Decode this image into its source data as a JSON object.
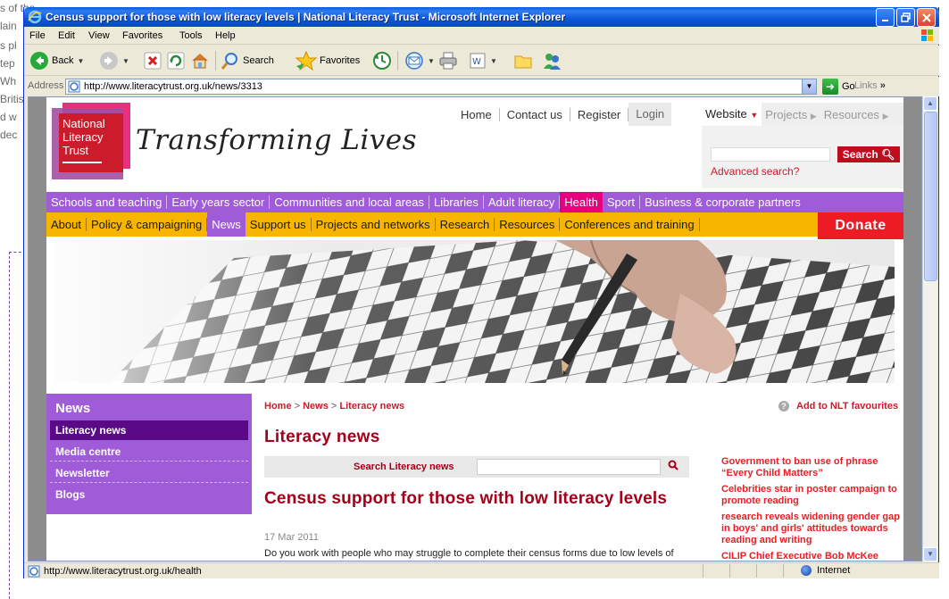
{
  "background_doc": {
    "lines": [
      "s of the public searching through census records to find",
      "lain",
      "s pl",
      "tep",
      "Wh",
      "Britis",
      "d w",
      "dec"
    ]
  },
  "window": {
    "title": "Census support for those with low literacy levels | National Literacy Trust - Microsoft Internet Explorer"
  },
  "menubar": {
    "items": [
      "File",
      "Edit",
      "View",
      "Favorites",
      "Tools",
      "Help"
    ]
  },
  "toolbar": {
    "back_label": "Back",
    "search_label": "Search",
    "favorites_label": "Favorites"
  },
  "addressbar": {
    "label": "Address",
    "url": "http://www.literacytrust.org.uk/news/3313",
    "go_label": "Go",
    "links_label": "Links"
  },
  "site": {
    "logo_lines": [
      "National",
      "Literacy",
      "Trust"
    ],
    "tagline": "Transforming Lives",
    "top_links": [
      "Home",
      "Contact us",
      "Register",
      "Login"
    ],
    "site_tabs": [
      "Website",
      "Projects",
      "Resources"
    ],
    "search_button": "Search",
    "advanced_search": "Advanced search?",
    "purple_nav": [
      "Schools and teaching",
      "Early years sector",
      "Communities and local areas",
      "Libraries",
      "Adult literacy",
      "Health",
      "Sport",
      "Business & corporate partners"
    ],
    "yellow_nav": [
      "About",
      "Policy & campaigning",
      "News",
      "Support us",
      "Projects and networks",
      "Research",
      "Resources",
      "Conferences and training"
    ],
    "donate": "Donate"
  },
  "leftnav": {
    "heading": "News",
    "items": [
      "Literacy news",
      "Media centre",
      "Newsletter",
      "Blogs"
    ]
  },
  "content": {
    "breadcrumb": [
      "Home",
      "News",
      "Literacy news"
    ],
    "favourites": "Add to NLT favourites",
    "section_title": "Literacy news",
    "search_label": "Search Literacy news",
    "article_title": "Census support for those with low literacy levels",
    "article_date": "17 Mar 2011",
    "article_body": "Do you work with people who may struggle to complete their census forms due to low levels of literacy? Help is available..."
  },
  "related": [
    "Government to ban use of phrase “Every Child Matters”",
    "Celebrities star in poster campaign to promote reading",
    "research reveals widening gender gap in boys' and girls' attitudes towards reading and writing",
    "CILIP Chief Executive Bob McKee"
  ],
  "statusbar": {
    "url": "http://www.literacytrust.org.uk/health",
    "zone": "Internet"
  },
  "colors": {
    "purple": "#a05bd8",
    "yellow": "#f7b500",
    "pink_active": "#e6007e",
    "red": "#cc1b2a",
    "donate": "#ed1c24"
  }
}
